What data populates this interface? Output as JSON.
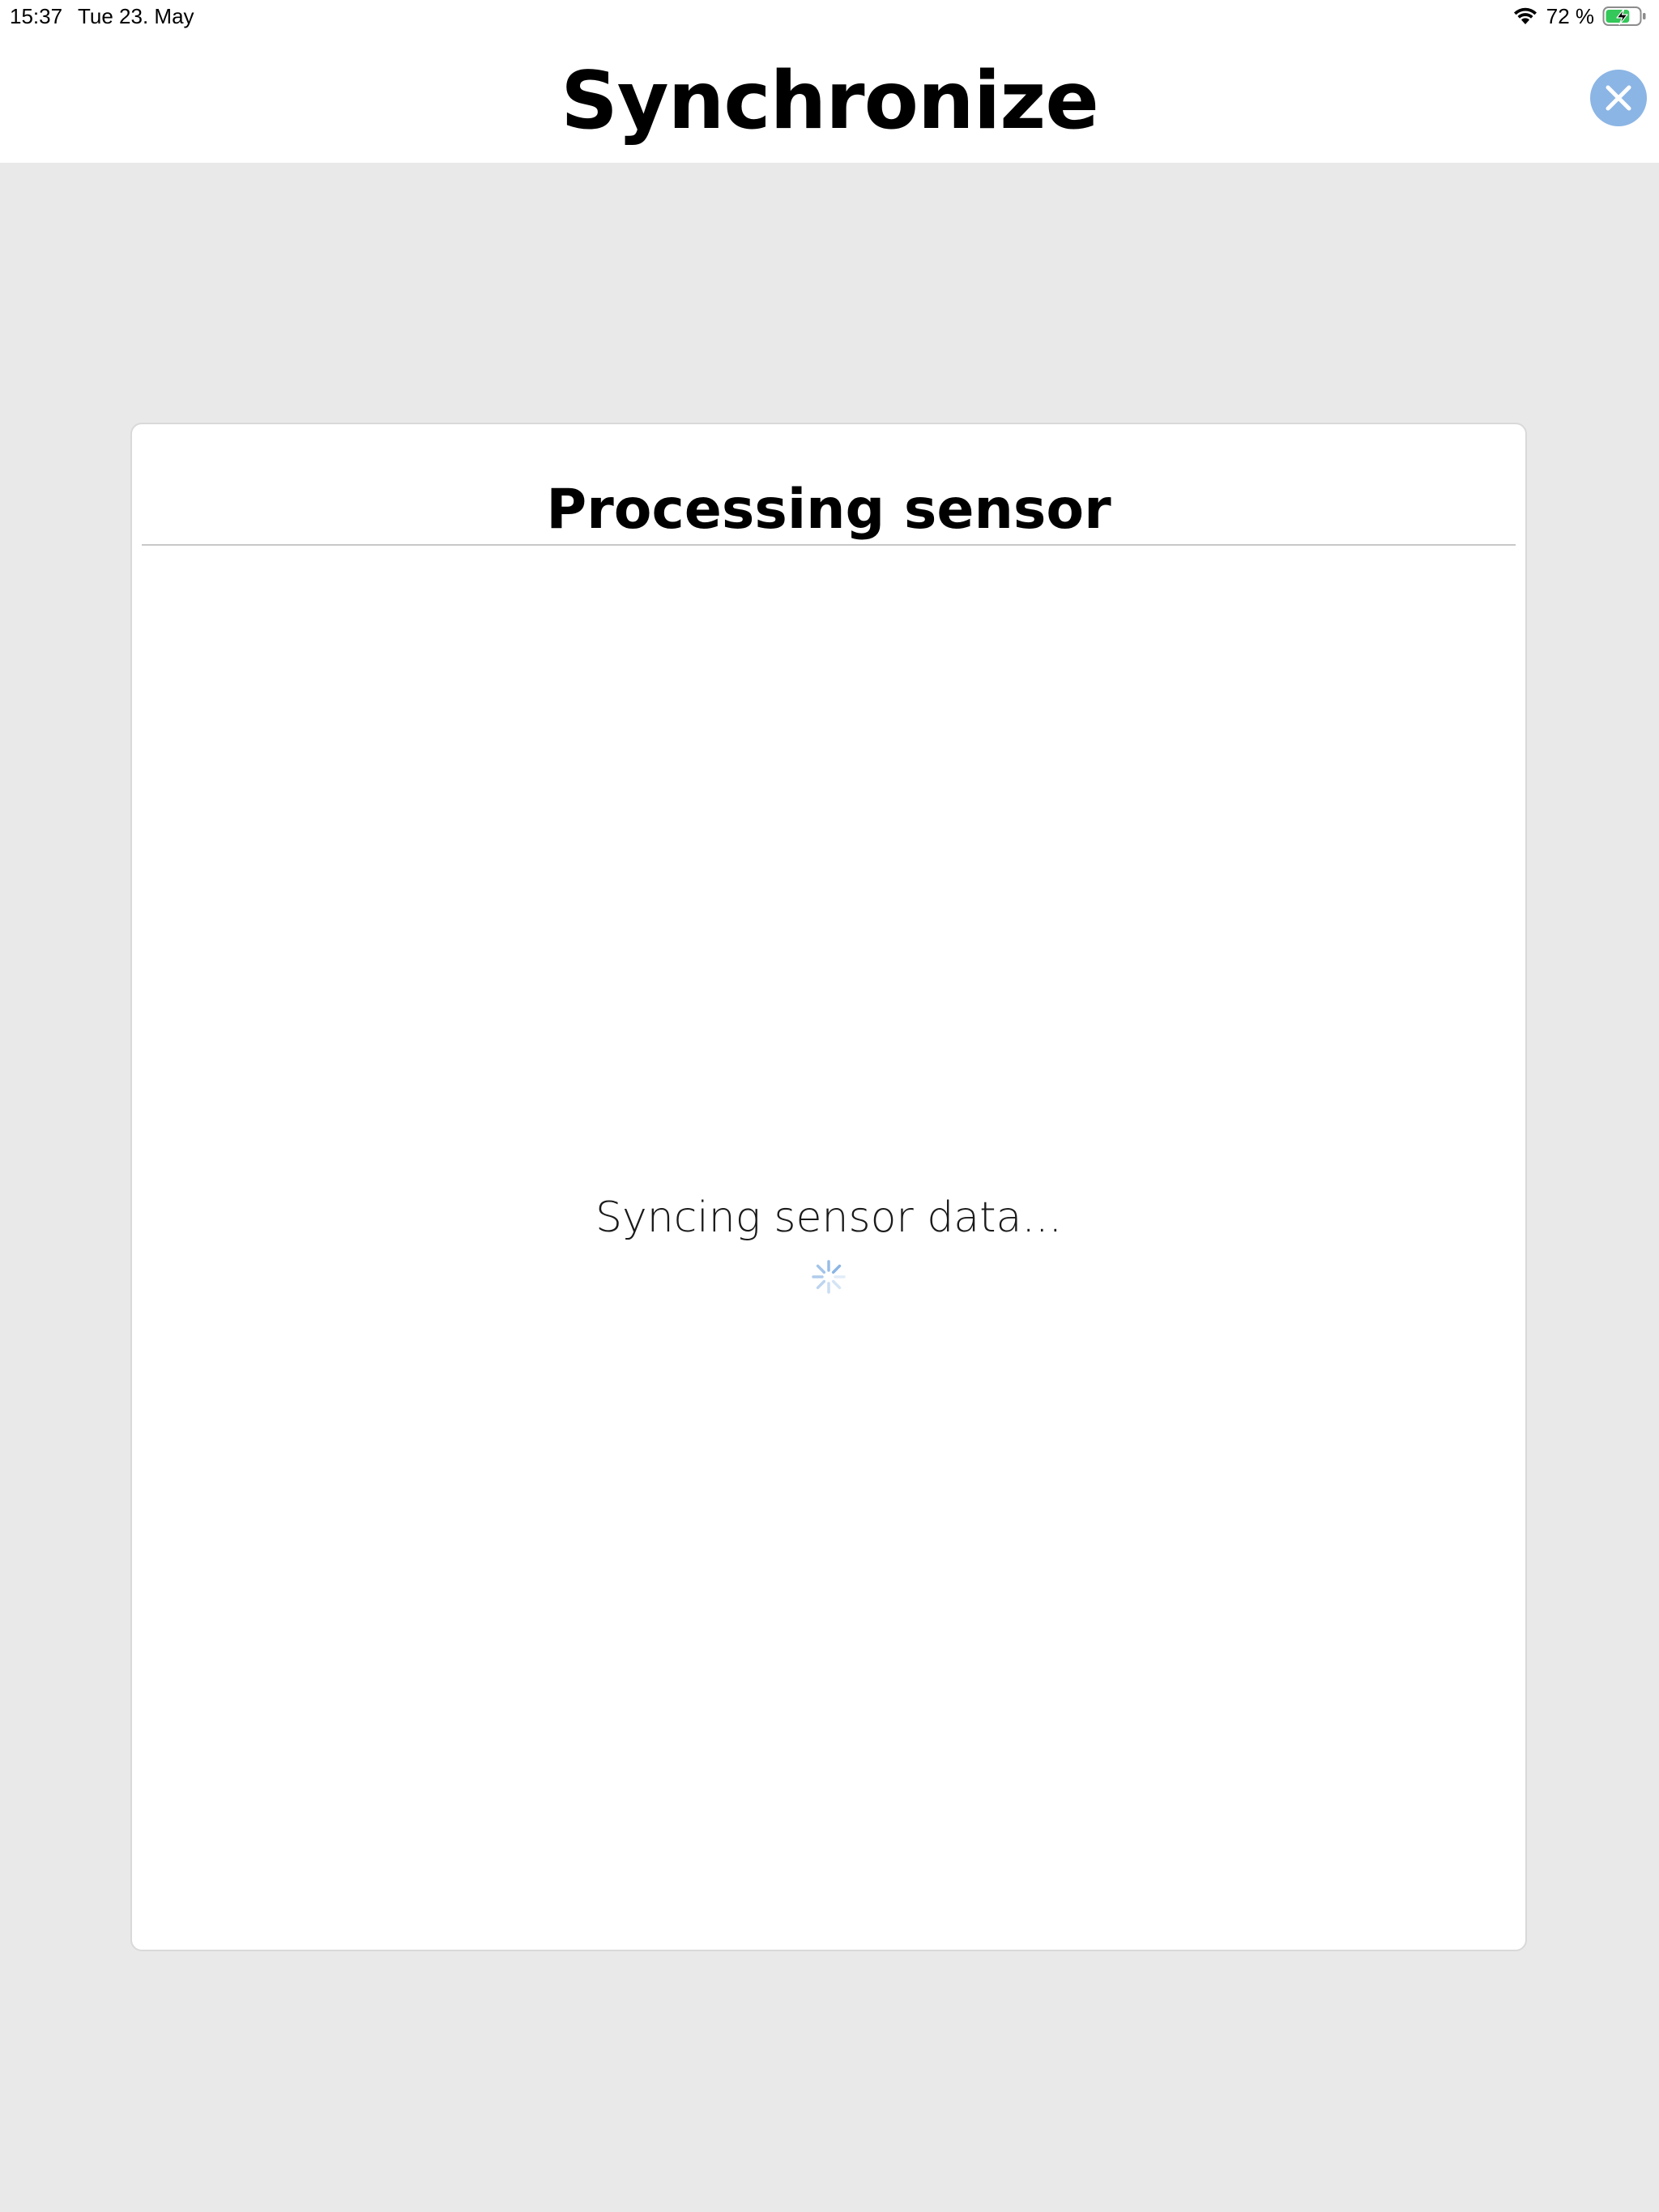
{
  "status_bar": {
    "time": "15:37",
    "date": "Tue 23. May",
    "battery_percent": "72 %",
    "battery_level": 0.72,
    "charging": true,
    "icons": [
      "wifi-icon",
      "battery-charging-icon"
    ]
  },
  "header": {
    "title": "Synchronize",
    "close_icon": "close-icon"
  },
  "card": {
    "title": "Processing sensor",
    "message": "Syncing sensor data...",
    "spinner_icon": "loading-spinner-icon"
  },
  "colors": {
    "background": "#e9e9e9",
    "surface": "#ffffff",
    "accent": "#8bb5e4",
    "battery_fill": "#34c759",
    "divider": "#c8c8c8"
  }
}
